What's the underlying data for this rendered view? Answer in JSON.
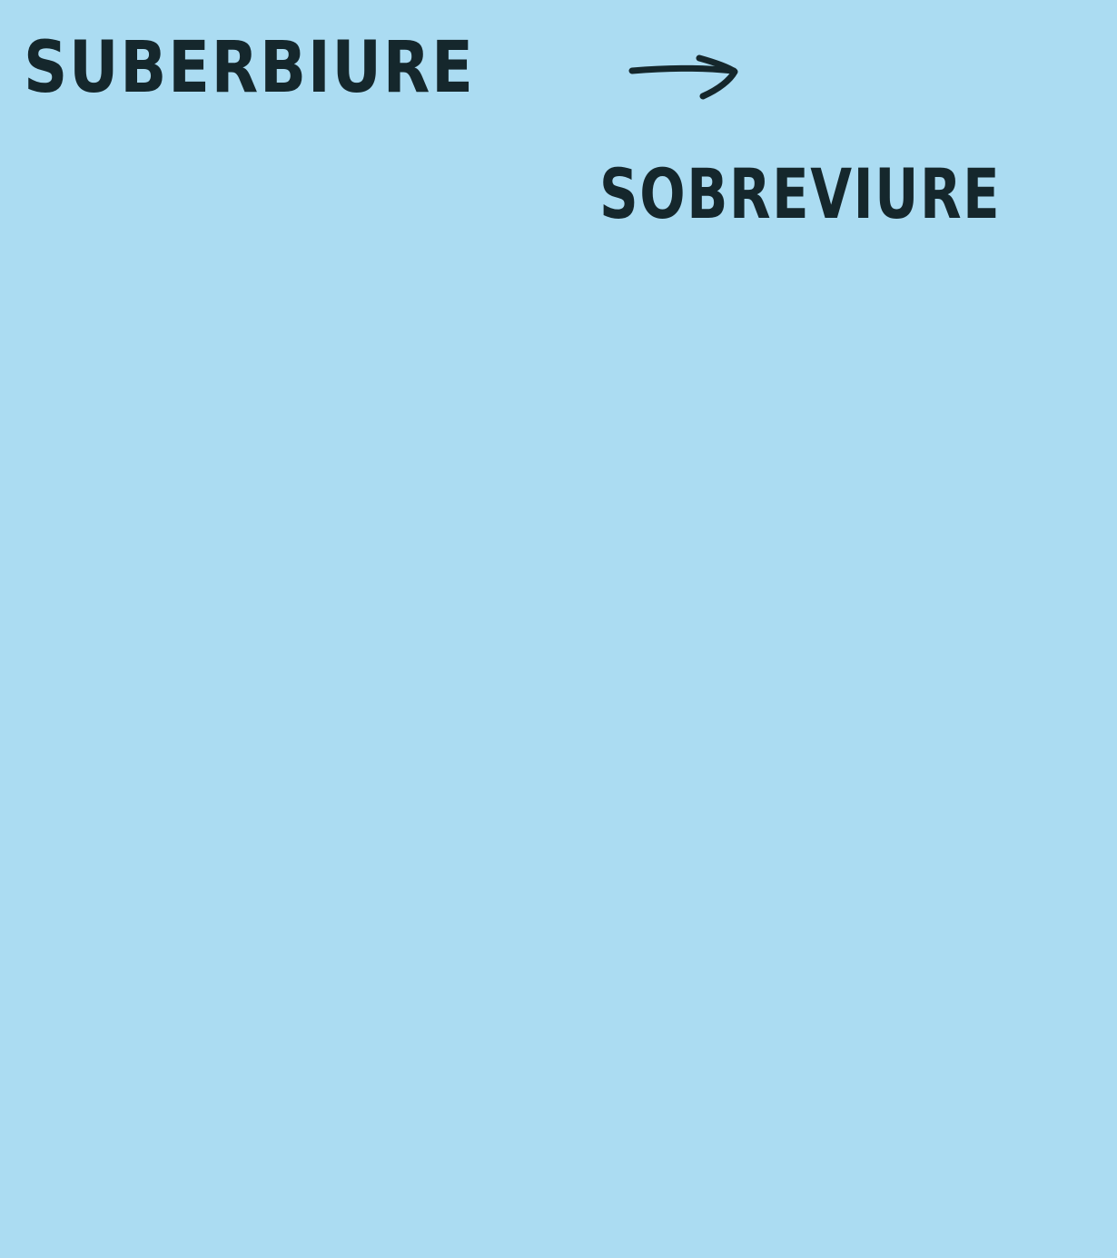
{
  "note": {
    "background_color": "#abdcf2",
    "ink_color": "#15272c",
    "word_from": "SUBERBIURE",
    "arrow_icon": "right-arrow-icon",
    "word_to": "SOBREVIURE"
  }
}
